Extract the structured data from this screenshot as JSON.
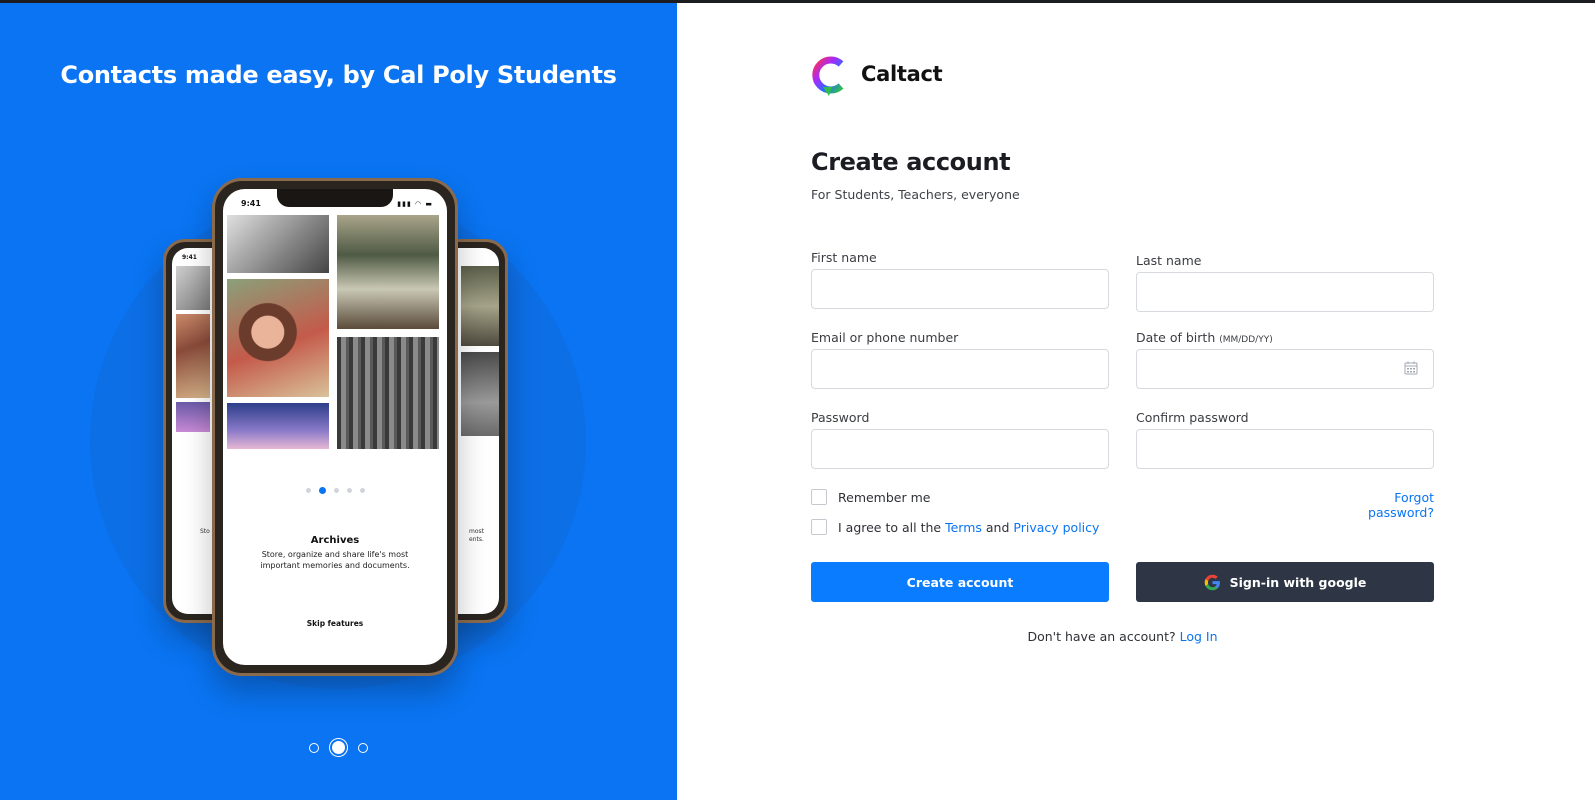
{
  "hero": {
    "title": "Contacts made easy, by Cal Poly Students",
    "phone": {
      "time": "9:41",
      "feature_title": "Archives",
      "feature_desc": "Store, organize and share life's most important memories and documents.",
      "skip": "Skip features",
      "side_left_text": "Sto impo",
      "side_right_text": "most ents.",
      "side_left_time": "9:41"
    },
    "carousel_active_index": 1
  },
  "brand": {
    "name": "Caltact"
  },
  "form": {
    "title": "Create account",
    "subtitle": "For Students, Teachers, everyone",
    "fields": {
      "first_name": {
        "label": "First name",
        "value": ""
      },
      "last_name": {
        "label": "Last name",
        "value": ""
      },
      "email": {
        "label": "Email or phone number",
        "value": ""
      },
      "dob": {
        "label": "Date of birth",
        "hint": "(MM/DD/YY)",
        "value": ""
      },
      "password": {
        "label": "Password",
        "value": ""
      },
      "confirm": {
        "label": "Confirm password",
        "value": ""
      }
    },
    "remember_me": "Remember me",
    "forgot": "Forgot password?",
    "agree_prefix": "I agree to all the",
    "terms": "Terms",
    "agree_and": "and",
    "privacy": "Privacy policy",
    "create_button": "Create account",
    "google_button": "Sign-in with google",
    "no_account": "Don't have an account?",
    "login": "Log In"
  },
  "colors": {
    "accent": "#0a7cff",
    "left_panel": "#0a74f2",
    "dark_button": "#2e3645"
  }
}
